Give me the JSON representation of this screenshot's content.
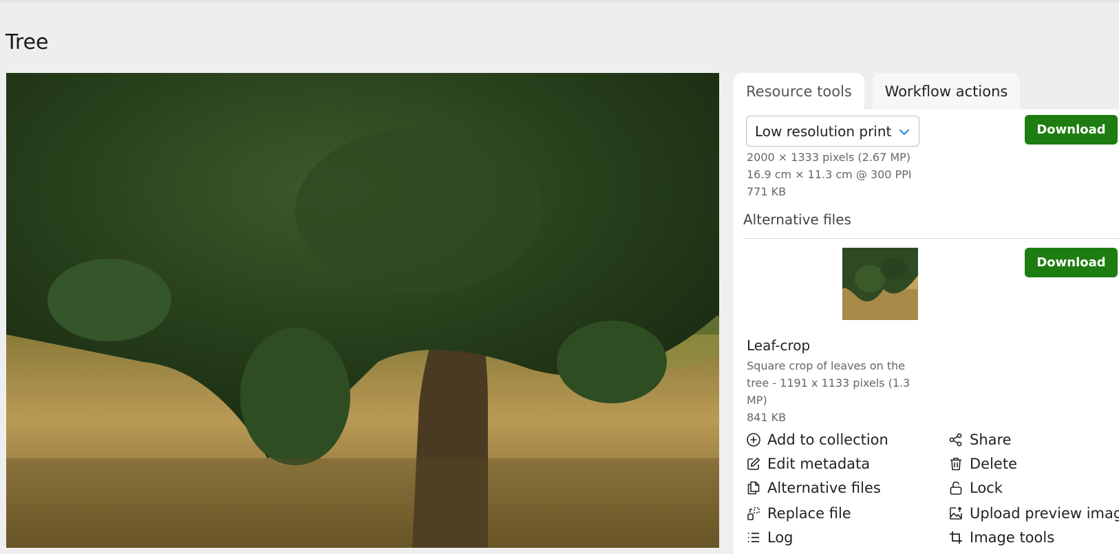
{
  "page": {
    "title": "Tree"
  },
  "tabs": [
    {
      "label": "Resource tools",
      "active": true
    },
    {
      "label": "Workflow actions",
      "active": false
    }
  ],
  "download": {
    "size_option": "Low resolution print",
    "button_label": "Download",
    "dimensions": "2000 × 1333 pixels (2.67 MP)",
    "print_size": "16.9 cm × 11.3 cm @ 300 PPI",
    "file_size": "771 KB"
  },
  "alternative_files": {
    "heading": "Alternative files",
    "items": [
      {
        "name": "Leaf-crop",
        "description": "Square crop of leaves on the tree - 1191 x 1133 pixels (1.3 MP)",
        "file_size": "841 KB",
        "button_label": "Download"
      }
    ]
  },
  "actions": {
    "add_to_collection": "Add to collection",
    "share": "Share",
    "edit_metadata": "Edit metadata",
    "delete": "Delete",
    "alternative_files": "Alternative files",
    "lock": "Lock",
    "replace_file": "Replace file",
    "upload_preview_image": "Upload preview image",
    "log": "Log",
    "image_tools": "Image tools"
  },
  "colors": {
    "download_button": "#1e7d10",
    "select_chevron": "#2a8fd4",
    "background": "#eeeeee"
  }
}
